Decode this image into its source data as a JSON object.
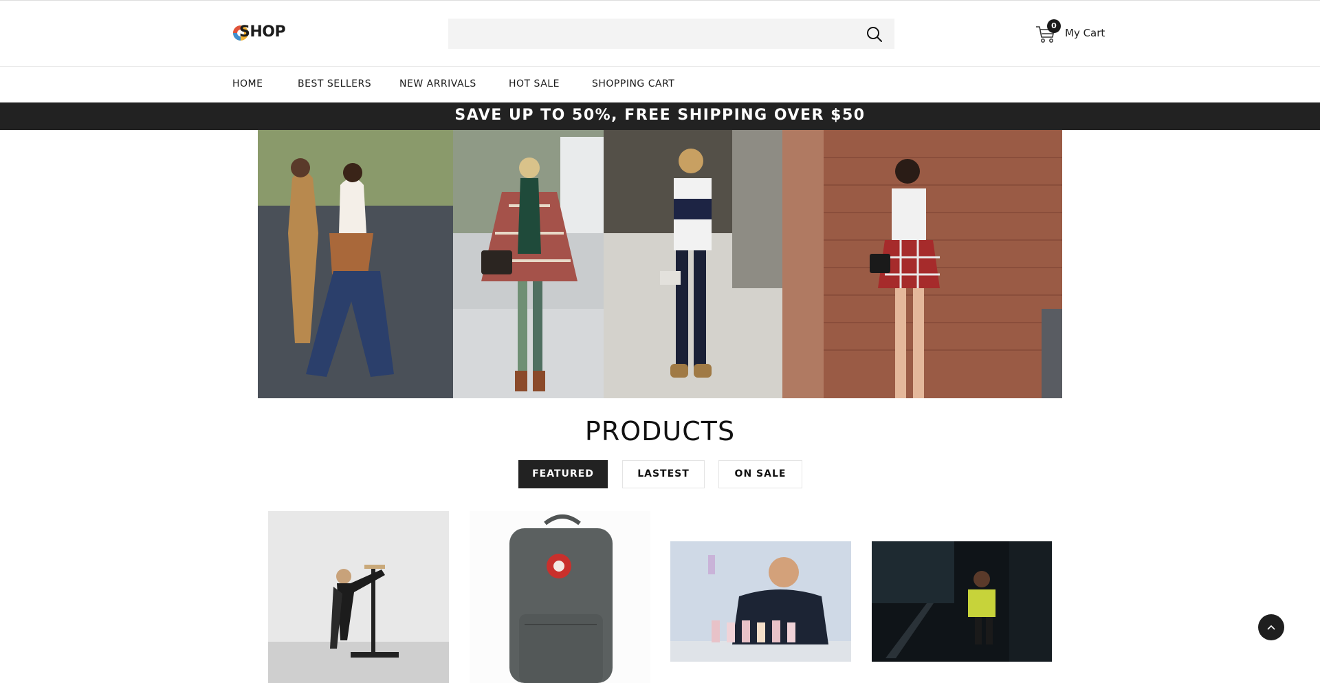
{
  "header": {
    "logo_text": "SHOP",
    "search": {
      "placeholder": "",
      "value": ""
    },
    "cart": {
      "count": "0",
      "label": "My Cart"
    }
  },
  "nav": {
    "items": [
      {
        "label": "HOME"
      },
      {
        "label": "BEST SELLERS"
      },
      {
        "label": "NEW ARRIVALS"
      },
      {
        "label": "HOT SALE"
      },
      {
        "label": "SHOPPING CART"
      }
    ]
  },
  "promo": {
    "text": "SAVE UP TO 50%, FREE SHIPPING OVER $50"
  },
  "products": {
    "title": "PRODUCTS",
    "tabs": [
      {
        "label": "FEATURED",
        "active": true
      },
      {
        "label": "LASTEST",
        "active": false
      },
      {
        "label": "ON SALE",
        "active": false
      }
    ]
  },
  "icons": {
    "search": "search-icon",
    "cart": "cart-icon",
    "back_to_top": "chevron-up-icon"
  },
  "colors": {
    "promo_bg": "#222222",
    "active_tab": "#222222",
    "search_bg": "#f3f3f3"
  }
}
